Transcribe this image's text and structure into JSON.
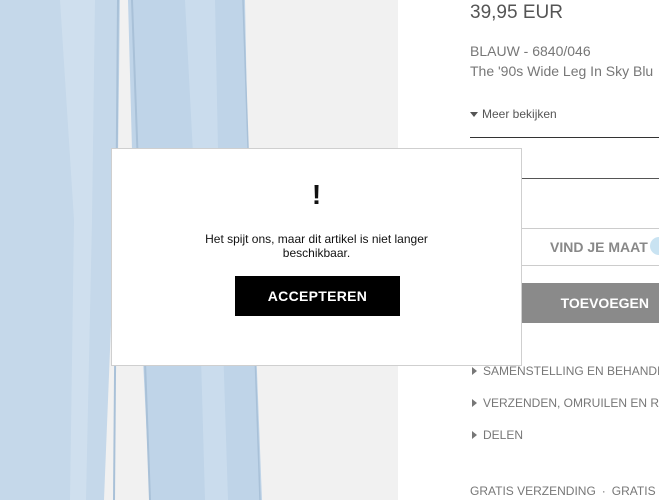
{
  "product": {
    "price": "39,95 EUR",
    "color_code": "BLAUW - 6840/046",
    "name": "The '90s Wide Leg In Sky Blu",
    "more_label": "Meer bekijken",
    "find_size_label": "VIND JE MAAT",
    "add_label": "TOEVOEGEN",
    "sections": [
      "SAMENSTELLING EN BEHANDI",
      "VERZENDEN, OMRUILEN EN RI",
      "DELEN"
    ],
    "shipping": [
      "GRATIS VERZENDING",
      "GRATIS"
    ]
  },
  "modal": {
    "icon": "!",
    "message": "Het spijt ons, maar dit artikel is niet langer beschikbaar.",
    "accept_label": "ACCEPTEREN"
  },
  "colors": {
    "denim": "#c6d9ea",
    "modal_button": "#000000",
    "add_button": "#8a8a8a"
  }
}
